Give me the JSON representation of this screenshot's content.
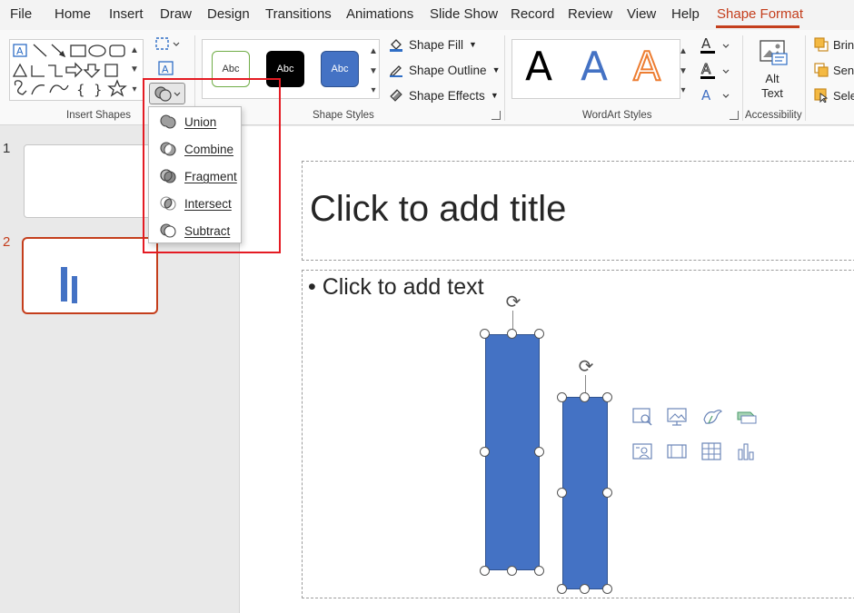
{
  "menu": {
    "tabs": [
      "File",
      "Home",
      "Insert",
      "Draw",
      "Design",
      "Transitions",
      "Animations",
      "Slide Show",
      "Record",
      "Review",
      "View",
      "Help",
      "Shape Format"
    ],
    "active_tab": "Shape Format"
  },
  "ribbon": {
    "groups": {
      "insert_shapes": "Insert Shapes",
      "shape_styles": "Shape Styles",
      "wordart_styles": "WordArt Styles",
      "accessibility": "Accessibility"
    },
    "shape_styles": {
      "presets": [
        "Abc",
        "Abc",
        "Abc"
      ],
      "fill": "Shape Fill",
      "outline": "Shape Outline",
      "effects": "Shape Effects"
    },
    "wordart_letters": [
      "A",
      "A",
      "A"
    ],
    "alt_text": {
      "line1": "Alt",
      "line2": "Text"
    },
    "arrange": [
      "Bring",
      "Send",
      "Sele"
    ]
  },
  "thumbnails": {
    "slides": [
      {
        "number": "1",
        "selected": false
      },
      {
        "number": "2",
        "selected": true
      }
    ]
  },
  "slide": {
    "title_placeholder": "Click to add title",
    "body_placeholder": "• Click to add text"
  },
  "merge_menu": {
    "items": [
      {
        "label": "Union",
        "icon": "union-icon"
      },
      {
        "label": "Combine",
        "icon": "combine-icon"
      },
      {
        "label": "Fragment",
        "icon": "fragment-icon"
      },
      {
        "label": "Intersect",
        "icon": "intersect-icon"
      },
      {
        "label": "Subtract",
        "icon": "subtract-icon"
      }
    ]
  },
  "colors": {
    "accent": "#c43e1c",
    "shape_fill": "#4472c4",
    "highlight": "#e41b23",
    "wordart_blue": "#4472c4",
    "wordart_orange": "#ed7d31"
  }
}
